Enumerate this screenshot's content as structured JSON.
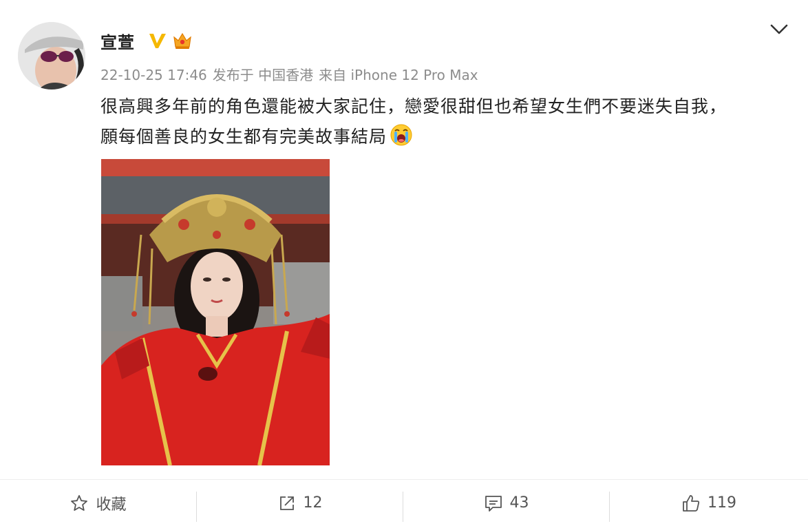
{
  "post": {
    "author": "宣萱",
    "meta": {
      "date": "22-10-25 17:46",
      "location": "发布于 中国香港",
      "source": "来自 iPhone 12 Pro Max"
    },
    "text_line1": "很高興多年前的角色還能被大家記住，戀愛很甜但也希望女生們不要迷失自我，",
    "text_line2": "願每個善良的女生都有完美故事結局"
  },
  "actions": {
    "favorite_label": "收藏",
    "share_count": "12",
    "comment_count": "43",
    "like_count": "119"
  },
  "colors": {
    "verified_badge": "#f5b800",
    "meta_text": "#8c8c8c",
    "photo_dress": "#d8231f"
  },
  "icons": {
    "verified": "verified-v-icon",
    "member": "crown-member-icon",
    "menu": "chevron-down-icon",
    "favorite": "star-icon",
    "share": "share-icon",
    "comment": "comment-icon",
    "like": "thumbs-up-icon",
    "emoji": "crying-face-emoji"
  }
}
